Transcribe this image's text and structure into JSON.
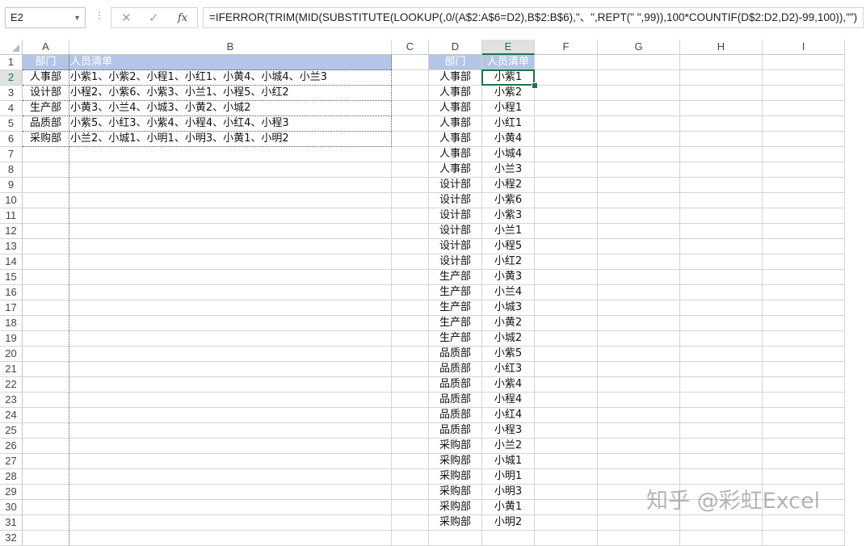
{
  "formula_bar": {
    "name_box": "E2",
    "cancel_icon": "cancel-icon",
    "enter_icon": "check-icon",
    "fx_label": "fx",
    "formula": "=IFERROR(TRIM(MID(SUBSTITUTE(LOOKUP(,0/(A$2:A$6=D2),B$2:B$6),\"、\",REPT(\" \",99)),100*COUNTIF(D$2:D2,D2)-99,100)),\"\")"
  },
  "columns": [
    "A",
    "B",
    "C",
    "D",
    "E",
    "F",
    "G",
    "H",
    "I"
  ],
  "selected_cell": "E2",
  "table1": {
    "headers": [
      "部门",
      "人员清单"
    ],
    "rows": [
      [
        "人事部",
        "小紫1、小紫2、小程1、小红1、小黄4、小城4、小兰3"
      ],
      [
        "设计部",
        "小程2、小紫6、小紫3、小兰1、小程5、小红2"
      ],
      [
        "生产部",
        "小黄3、小兰4、小城3、小黄2、小城2"
      ],
      [
        "品质部",
        "小紫5、小红3、小紫4、小程4、小红4、小程3"
      ],
      [
        "采购部",
        "小兰2、小城1、小明1、小明3、小黄1、小明2"
      ]
    ]
  },
  "table2": {
    "headers": [
      "部门",
      "人员清单"
    ],
    "rows": [
      [
        "人事部",
        "小紫1"
      ],
      [
        "人事部",
        "小紫2"
      ],
      [
        "人事部",
        "小程1"
      ],
      [
        "人事部",
        "小红1"
      ],
      [
        "人事部",
        "小黄4"
      ],
      [
        "人事部",
        "小城4"
      ],
      [
        "人事部",
        "小兰3"
      ],
      [
        "设计部",
        "小程2"
      ],
      [
        "设计部",
        "小紫6"
      ],
      [
        "设计部",
        "小紫3"
      ],
      [
        "设计部",
        "小兰1"
      ],
      [
        "设计部",
        "小程5"
      ],
      [
        "设计部",
        "小红2"
      ],
      [
        "生产部",
        "小黄3"
      ],
      [
        "生产部",
        "小兰4"
      ],
      [
        "生产部",
        "小城3"
      ],
      [
        "生产部",
        "小黄2"
      ],
      [
        "生产部",
        "小城2"
      ],
      [
        "品质部",
        "小紫5"
      ],
      [
        "品质部",
        "小红3"
      ],
      [
        "品质部",
        "小紫4"
      ],
      [
        "品质部",
        "小程4"
      ],
      [
        "品质部",
        "小红4"
      ],
      [
        "品质部",
        "小程3"
      ],
      [
        "采购部",
        "小兰2"
      ],
      [
        "采购部",
        "小城1"
      ],
      [
        "采购部",
        "小明1"
      ],
      [
        "采购部",
        "小明3"
      ],
      [
        "采购部",
        "小黄1"
      ],
      [
        "采购部",
        "小明2"
      ]
    ]
  },
  "watermark": "知乎 @彩虹Excel",
  "colors": {
    "header_fill": "#b4c6e7",
    "header_text": "#ffffff",
    "selection": "#217346",
    "gridline": "#d4d4d4"
  }
}
